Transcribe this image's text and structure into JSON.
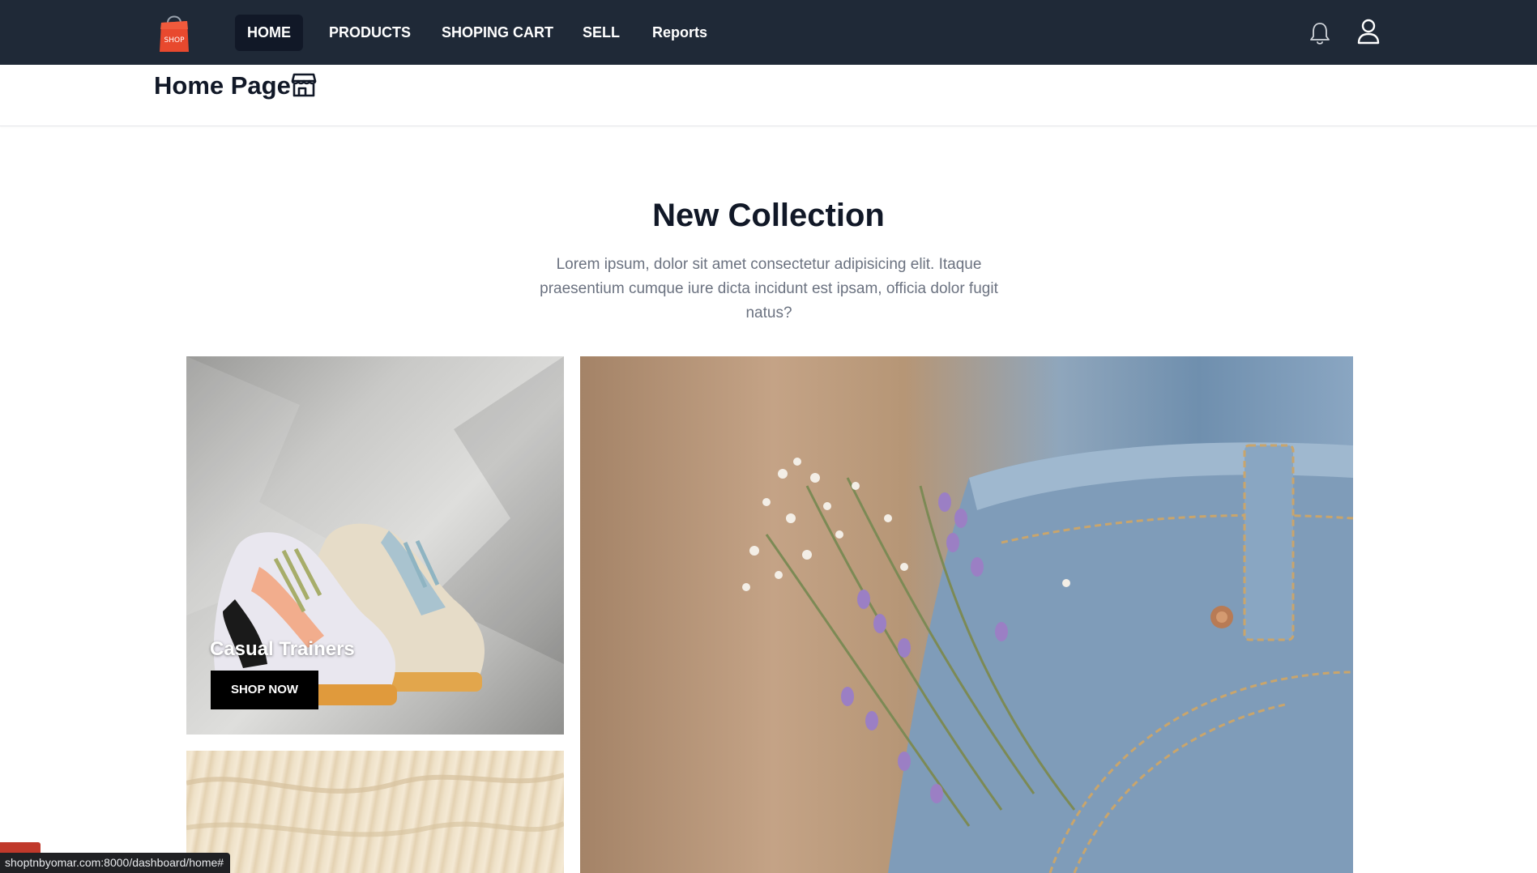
{
  "nav": {
    "logo_text": "SHOP",
    "items": [
      {
        "label": "HOME",
        "active": true
      },
      {
        "label": "PRODUCTS",
        "active": false
      },
      {
        "label": "SHOPING CART",
        "active": false
      },
      {
        "label": "SELL",
        "active": false
      },
      {
        "label": "Reports",
        "active": false
      }
    ],
    "icons": [
      "bell-icon",
      "user-icon"
    ]
  },
  "page": {
    "title": "Home Page",
    "title_icon": "store-icon"
  },
  "collection": {
    "title": "New Collection",
    "description": "Lorem ipsum, dolor sit amet consectetur adipisicing elit. Itaque praesentium cumque iure dicta incidunt est ipsam, officia dolor fugit natus?",
    "cards": [
      {
        "label": "Casual Trainers",
        "button": "SHOP NOW"
      }
    ]
  },
  "status_bar": {
    "url": "shoptnbyomar.com:8000/dashboard/home#"
  },
  "colors": {
    "navbar_bg": "#1f2937",
    "active_nav_bg": "#111827",
    "logo_red": "#e8492e",
    "button_bg": "#000000"
  }
}
